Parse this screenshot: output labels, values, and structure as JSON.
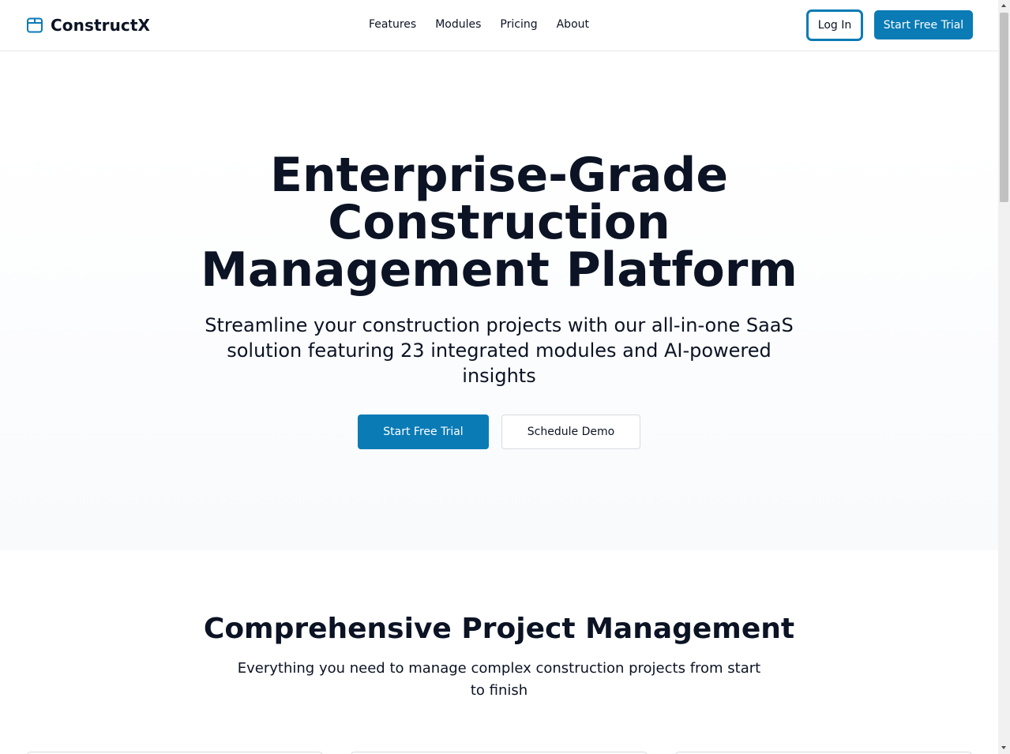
{
  "header": {
    "brand": "ConstructX",
    "nav": [
      "Features",
      "Modules",
      "Pricing",
      "About"
    ],
    "login_label": "Log In",
    "trial_label": "Start Free Trial"
  },
  "hero": {
    "title_lines": [
      "Enterprise-Grade",
      "Construction",
      "Management Platform"
    ],
    "subtitle": "Streamline your construction projects with our all-in-one SaaS solution featuring 23 integrated modules and AI-powered insights",
    "primary_cta": "Start Free Trial",
    "secondary_cta": "Schedule Demo"
  },
  "section": {
    "title": "Comprehensive Project Management",
    "subtitle": "Everything you need to manage complex construction projects from start to finish"
  },
  "colors": {
    "accent": "#0a7bb5",
    "text": "#0b1324",
    "border": "#e5e7eb"
  },
  "icons": {
    "brand": "box-icon",
    "scroll_up": "scroll-up-arrow",
    "scroll_down": "scroll-down-arrow"
  }
}
